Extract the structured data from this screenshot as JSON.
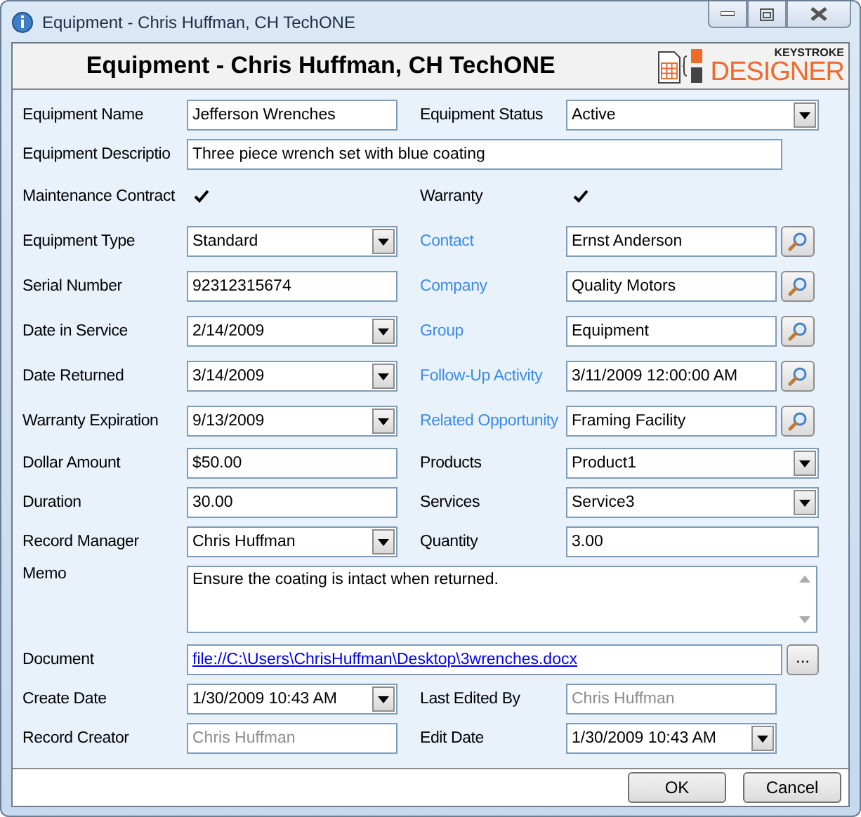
{
  "window": {
    "title": "Equipment - Chris Huffman, CH TechONE"
  },
  "header": {
    "title": "Equipment - Chris Huffman, CH TechONE",
    "logo_top": "KEYSTROKE",
    "logo_bottom": "DESIGNER"
  },
  "rows": [
    {
      "left": {
        "label": "Equipment Name",
        "kind": "text",
        "value": "Jefferson Wrenches"
      },
      "right": {
        "label": "Equipment Status",
        "kind": "dropdown",
        "value": "Active"
      }
    },
    {
      "full": {
        "label": "Equipment Descriptio",
        "kind": "text",
        "value": "Three piece wrench set with blue coating"
      }
    },
    {
      "left": {
        "label": "Maintenance Contract",
        "kind": "checkbox",
        "checked": true
      },
      "right": {
        "label": "Warranty",
        "kind": "checkbox",
        "checked": true
      }
    },
    {
      "left": {
        "label": "Equipment Type",
        "kind": "dropdown",
        "value": "Standard"
      },
      "right": {
        "label": "Contact",
        "kind": "lookup",
        "value": "Ernst Anderson"
      }
    },
    {
      "left": {
        "label": "Serial Number",
        "kind": "text",
        "value": "92312315674"
      },
      "right": {
        "label": "Company",
        "kind": "lookup",
        "value": "Quality Motors"
      }
    },
    {
      "left": {
        "label": "Date in Service",
        "kind": "date",
        "value": "2/14/2009"
      },
      "right": {
        "label": "Group",
        "kind": "lookup",
        "value": "Equipment"
      }
    },
    {
      "left": {
        "label": "Date Returned",
        "kind": "date",
        "value": "3/14/2009"
      },
      "right": {
        "label": "Follow-Up Activity",
        "kind": "lookup",
        "value": "3/11/2009 12:00:00 AM"
      }
    },
    {
      "left": {
        "label": "Warranty Expiration",
        "kind": "date",
        "value": "9/13/2009"
      },
      "right": {
        "label": "Related Opportunity",
        "kind": "lookup",
        "value": "Framing Facility"
      }
    },
    {
      "left": {
        "label": "Dollar Amount",
        "kind": "text",
        "value": "$50.00"
      },
      "right": {
        "label": "Products",
        "kind": "dropdown",
        "value": "Product1"
      }
    },
    {
      "left": {
        "label": "Duration",
        "kind": "text",
        "value": "30.00"
      },
      "right": {
        "label": "Services",
        "kind": "dropdown",
        "value": "Service3"
      }
    },
    {
      "left": {
        "label": "Record Manager",
        "kind": "date",
        "value": "Chris Huffman"
      },
      "right": {
        "label": "Quantity",
        "kind": "text",
        "value": "3.00"
      }
    },
    {
      "full": {
        "label": "Memo",
        "kind": "memo",
        "value": "Ensure the coating is intact when returned."
      }
    },
    {
      "full": {
        "label": "Document",
        "kind": "document",
        "value": "file://C:\\Users\\ChrisHuffman\\Desktop\\3wrenches.docx",
        "button": "..."
      }
    },
    {
      "left": {
        "label": "Create Date",
        "kind": "date",
        "value": "1/30/2009 10:43 AM"
      },
      "right": {
        "label": "Last Edited By",
        "kind": "text",
        "value": "Chris Huffman",
        "disabled": true
      }
    },
    {
      "left": {
        "label": "Record Creator",
        "kind": "text",
        "value": "Chris Huffman",
        "disabled": true
      },
      "right": {
        "label": "Edit Date",
        "kind": "date",
        "value": "1/30/2009 10:43 AM"
      }
    }
  ],
  "buttons": [
    "OK",
    "Cancel"
  ]
}
